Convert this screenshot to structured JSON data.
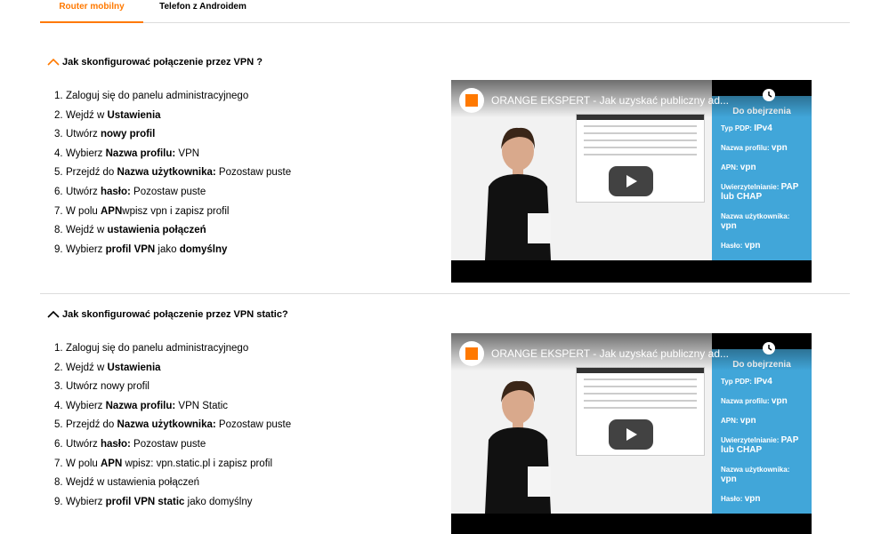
{
  "tabs": [
    {
      "label": "Router mobilny",
      "active": true
    },
    {
      "label": "Telefon z Androidem",
      "active": false
    }
  ],
  "accent_color": "#ff7900",
  "sections": [
    {
      "title": "Jak skonfigurować połączenie przez VPN ?",
      "chevron_color": "#ff7900",
      "steps": [
        {
          "n": "1.",
          "parts": [
            {
              "t": "Zaloguj się do panelu administracyjnego",
              "b": false
            }
          ]
        },
        {
          "n": "2.",
          "parts": [
            {
              "t": "Wejdź w ",
              "b": false
            },
            {
              "t": "Ustawienia",
              "b": true
            }
          ]
        },
        {
          "n": "3.",
          "parts": [
            {
              "t": "Utwórz ",
              "b": false
            },
            {
              "t": "nowy profil",
              "b": true
            }
          ]
        },
        {
          "n": "4.",
          "parts": [
            {
              "t": "Wybierz ",
              "b": false
            },
            {
              "t": "Nazwa profilu:",
              "b": true
            },
            {
              "t": " VPN",
              "b": false
            }
          ]
        },
        {
          "n": "5.",
          "parts": [
            {
              "t": "Przejdź do ",
              "b": false
            },
            {
              "t": "Nazwa użytkownika:",
              "b": true
            },
            {
              "t": " Pozostaw puste",
              "b": false
            }
          ]
        },
        {
          "n": "6.",
          "parts": [
            {
              "t": "Utwórz ",
              "b": false
            },
            {
              "t": "hasło:",
              "b": true
            },
            {
              "t": " Pozostaw puste",
              "b": false
            }
          ]
        },
        {
          "n": "7.",
          "parts": [
            {
              "t": "W polu ",
              "b": false
            },
            {
              "t": "APN",
              "b": true
            },
            {
              "t": "wpisz vpn i zapisz profil",
              "b": false
            }
          ]
        },
        {
          "n": "8.",
          "parts": [
            {
              "t": "Wejdź w ",
              "b": false
            },
            {
              "t": "ustawienia połączeń",
              "b": true
            }
          ]
        },
        {
          "n": "9.",
          "parts": [
            {
              "t": "Wybierz ",
              "b": false
            },
            {
              "t": "profil VPN",
              "b": true
            },
            {
              "t": " jako ",
              "b": false
            },
            {
              "t": "domyślny",
              "b": true
            }
          ]
        }
      ],
      "video": {
        "title": "ORANGE EKSPERT - Jak uzyskać publiczny ad...",
        "panel_title": "Do obejrzenia",
        "rows": [
          {
            "label": "Typ PDP:",
            "value": "IPv4"
          },
          {
            "label": "Nazwa profilu:",
            "value": "vpn"
          },
          {
            "label": "APN:",
            "value": "vpn"
          },
          {
            "label": "Uwierzytelnianie:",
            "value": "PAP lub CHAP"
          },
          {
            "label": "Nazwa użytkownika:",
            "value": "vpn"
          },
          {
            "label": "Hasło:",
            "value": "vpn"
          }
        ]
      }
    },
    {
      "title": "Jak skonfigurować połączenie przez VPN static?",
      "chevron_color": "#000000",
      "steps": [
        {
          "n": "1.",
          "parts": [
            {
              "t": "Zaloguj się do panelu administracyjnego",
              "b": false
            }
          ]
        },
        {
          "n": "2.",
          "parts": [
            {
              "t": "Wejdź w ",
              "b": false
            },
            {
              "t": "Ustawienia",
              "b": true
            }
          ]
        },
        {
          "n": "3.",
          "parts": [
            {
              "t": "Utwórz nowy profil",
              "b": false
            }
          ]
        },
        {
          "n": "4.",
          "parts": [
            {
              "t": "Wybierz ",
              "b": false
            },
            {
              "t": "Nazwa profilu:",
              "b": true
            },
            {
              "t": " VPN Static",
              "b": false
            }
          ]
        },
        {
          "n": "5.",
          "parts": [
            {
              "t": "Przejdź do ",
              "b": false
            },
            {
              "t": "Nazwa użytkownika:",
              "b": true
            },
            {
              "t": " Pozostaw puste",
              "b": false
            }
          ]
        },
        {
          "n": "6.",
          "parts": [
            {
              "t": "Utwórz ",
              "b": false
            },
            {
              "t": "hasło:",
              "b": true
            },
            {
              "t": " Pozostaw puste",
              "b": false
            }
          ]
        },
        {
          "n": "7.",
          "parts": [
            {
              "t": "W polu ",
              "b": false
            },
            {
              "t": "APN",
              "b": true
            },
            {
              "t": " wpisz: vpn.static.pl i zapisz profil",
              "b": false
            }
          ]
        },
        {
          "n": "8.",
          "parts": [
            {
              "t": "Wejdź w ustawienia połączeń",
              "b": false
            }
          ]
        },
        {
          "n": "9.",
          "parts": [
            {
              "t": "Wybierz ",
              "b": false
            },
            {
              "t": "profil VPN static",
              "b": true
            },
            {
              "t": " jako domyślny",
              "b": false
            }
          ]
        }
      ],
      "video": {
        "title": "ORANGE EKSPERT - Jak uzyskać publiczny ad...",
        "panel_title": "Do obejrzenia",
        "rows": [
          {
            "label": "Typ PDP:",
            "value": "IPv4"
          },
          {
            "label": "Nazwa profilu:",
            "value": "vpn"
          },
          {
            "label": "APN:",
            "value": "vpn"
          },
          {
            "label": "Uwierzytelnianie:",
            "value": "PAP lub CHAP"
          },
          {
            "label": "Nazwa użytkownika:",
            "value": "vpn"
          },
          {
            "label": "Hasło:",
            "value": "vpn"
          }
        ]
      }
    }
  ]
}
